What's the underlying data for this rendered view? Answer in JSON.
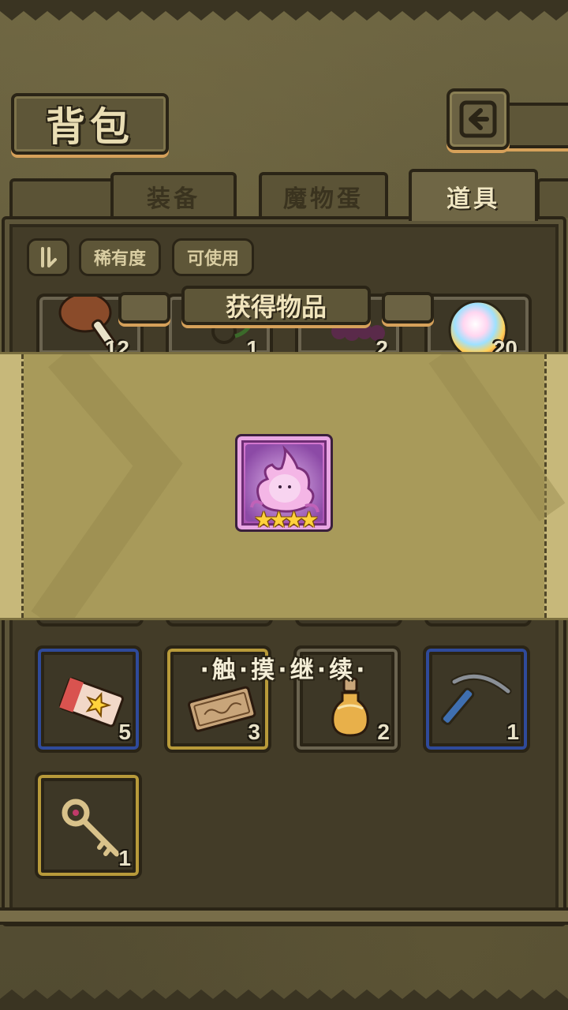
{
  "header": {
    "title": "背包",
    "back_icon": "back-arrow-icon"
  },
  "tabs": [
    {
      "label": "装备",
      "active": false
    },
    {
      "label": "魔物蛋",
      "active": false
    },
    {
      "label": "道具",
      "active": true
    }
  ],
  "filters": {
    "toggle_icon": "toggle-icon",
    "rarity_label": "稀有度",
    "usable_label": "可使用"
  },
  "partial_items": [
    {
      "icon": "meat-icon",
      "count": "12"
    },
    {
      "icon": "herb-icon",
      "count": "1"
    },
    {
      "icon": "grape-icon",
      "count": "2"
    },
    {
      "icon": "rainbow-orb-icon",
      "count": "20"
    }
  ],
  "items": [
    {
      "icon": "star-ticket-icon",
      "count": "5",
      "rim": "#2f4a9a"
    },
    {
      "icon": "coupon-icon",
      "count": "3",
      "rim": "#b89a3a"
    },
    {
      "icon": "potion-bottle-icon",
      "count": "2",
      "rim": "#6b6450"
    },
    {
      "icon": "pickaxe-icon",
      "count": "1",
      "rim": "#2f4a9a"
    },
    {
      "icon": "key-icon",
      "count": "1",
      "rim": "#b89a3a"
    }
  ],
  "popup": {
    "title": "获得物品",
    "reward_icon": "pink-slime-monster-icon",
    "stars": "★★★★",
    "hint": "·触·摸·继·续·"
  },
  "colors": {
    "rarity_blue": "#2f4a9a",
    "rarity_gold": "#b89a3a",
    "rarity_gray": "#6b6450",
    "reward_pink": "#d77ad1"
  }
}
